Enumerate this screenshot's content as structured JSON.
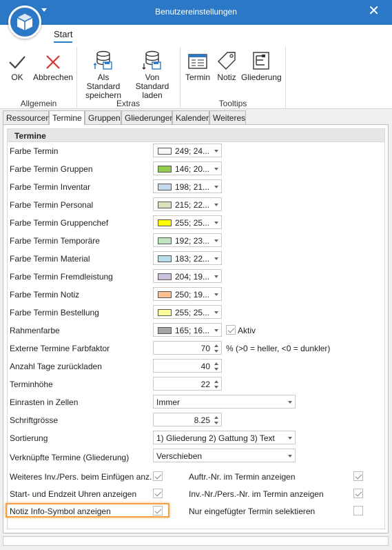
{
  "window": {
    "title": "Benutzereinstellungen",
    "close_glyph": "✕",
    "icon": "cube-icon"
  },
  "ribbon": {
    "tab": "Start",
    "groups": [
      {
        "label": "Allgemein",
        "buttons": [
          {
            "label": "OK",
            "icon": "checkmark-icon"
          },
          {
            "label": "Abbrechen",
            "icon": "cross-icon"
          }
        ]
      },
      {
        "label": "Extras",
        "buttons": [
          {
            "label": "Als Standard speichern",
            "icon": "database-save-icon"
          },
          {
            "label": "Von Standard laden",
            "icon": "database-load-icon"
          }
        ]
      },
      {
        "label": "Tooltips",
        "buttons": [
          {
            "label": "Termin",
            "icon": "calendar-icon"
          },
          {
            "label": "Notiz",
            "icon": "tag-icon"
          },
          {
            "label": "Gliederung",
            "icon": "outline-icon"
          }
        ]
      }
    ]
  },
  "tabs": [
    "Ressourcen",
    "Termine",
    "Gruppen",
    "Gliederungen",
    "Kalender",
    "Weiteres"
  ],
  "active_tab": "Termine",
  "section_title": "Termine",
  "color_rows": [
    {
      "label": "Farbe Termin",
      "value": "249; 24...",
      "color": "#f9f8f9"
    },
    {
      "label": "Farbe Termin Gruppen",
      "value": "146; 20...",
      "color": "#92cc4c"
    },
    {
      "label": "Farbe Termin Inventar",
      "value": "198; 21...",
      "color": "#c6d7ee"
    },
    {
      "label": "Farbe Termin Personal",
      "value": "215; 22...",
      "color": "#d7e4bd"
    },
    {
      "label": "Farbe Termin Gruppenchef",
      "value": "255; 25...",
      "color": "#ffff00"
    },
    {
      "label": "Farbe Termin Temporäre",
      "value": "192; 23...",
      "color": "#c0e6c0"
    },
    {
      "label": "Farbe Termin Material",
      "value": "183; 22...",
      "color": "#b7dde8"
    },
    {
      "label": "Farbe Termin Fremdleistung",
      "value": "204; 19...",
      "color": "#ccc0da"
    },
    {
      "label": "Farbe Termin Notiz",
      "value": "250; 19...",
      "color": "#fac090"
    },
    {
      "label": "Farbe Termin Bestellung",
      "value": "255; 25...",
      "color": "#ffff99"
    },
    {
      "label": "Rahmenfarbe",
      "value": "165; 16...",
      "color": "#a5a5a5"
    }
  ],
  "aktiv": {
    "label": "Aktiv",
    "checked": true
  },
  "farbfaktor": {
    "label": "Externe Termine Farbfaktor",
    "value": "70",
    "hint": "% (>0 = heller, <0 = dunkler)"
  },
  "tage_zurueck": {
    "label": "Anzahl Tage zurückladen",
    "value": "40"
  },
  "terminhoehe": {
    "label": "Terminhöhe",
    "value": "22"
  },
  "einrasten": {
    "label": "Einrasten in Zellen",
    "value": "Immer"
  },
  "schriftgroesse": {
    "label": "Schriftgrösse",
    "value": "8.25"
  },
  "sortierung": {
    "label": "Sortierung",
    "value": "1) Gliederung 2) Gattung 3) Text"
  },
  "verknuepft": {
    "label": "Verknüpfte Termine (Gliederung)",
    "value": "Verschieben"
  },
  "checks_left": [
    {
      "label": "Weiteres Inv./Pers. beim Einfügen anz.",
      "checked": true
    },
    {
      "label": "Start- und Endzeit Uhren anzeigen",
      "checked": true
    },
    {
      "label": "Notiz Info-Symbol anzeigen",
      "checked": true
    }
  ],
  "checks_right": [
    {
      "label": "Auftr.-Nr. im Termin anzeigen",
      "checked": true
    },
    {
      "label": "Inv.-Nr./Pers.-Nr. im Termin anzeigen",
      "checked": true
    },
    {
      "label": "Nur eingefügter Termin selektieren",
      "checked": false
    }
  ],
  "highlight_color": "#f5a142"
}
